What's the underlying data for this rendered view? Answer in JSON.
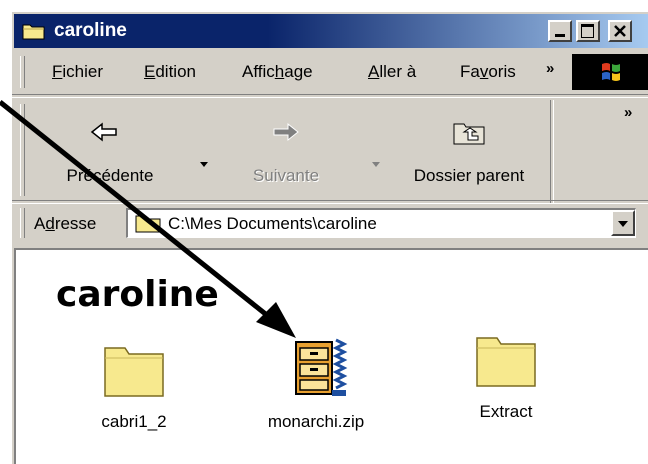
{
  "window": {
    "title": "caroline"
  },
  "title_buttons": {
    "minimize": "_",
    "maximize": "□",
    "close": "✕"
  },
  "menu": [
    {
      "prefix": "",
      "key": "F",
      "rest": "ichier"
    },
    {
      "prefix": "",
      "key": "E",
      "rest": "dition"
    },
    {
      "prefix": "Affic",
      "key": "h",
      "rest": "age"
    },
    {
      "prefix": "",
      "key": "A",
      "rest": "ller à"
    },
    {
      "prefix": "Fa",
      "key": "v",
      "rest": "oris"
    }
  ],
  "toolbar": {
    "back_label": "Précédente",
    "forward_label": "Suivante",
    "up_label": "Dossier parent",
    "more": "»"
  },
  "menu_more": "»",
  "address": {
    "label_prefix": "A",
    "label_key": "d",
    "label_rest": "resse",
    "path": "C:\\Mes Documents\\caroline"
  },
  "content": {
    "folder_title": "caroline",
    "files": [
      {
        "name": "cabri1_2",
        "icon": "folder-icon"
      },
      {
        "name": "monarchi.zip",
        "icon": "zip-icon"
      },
      {
        "name": "Extract",
        "icon": "folder-icon"
      }
    ]
  },
  "colors": {
    "titlebar_start": "#0a246a",
    "titlebar_end": "#a6caf0",
    "face": "#d4d0c8",
    "folder": "#f7e98e"
  }
}
